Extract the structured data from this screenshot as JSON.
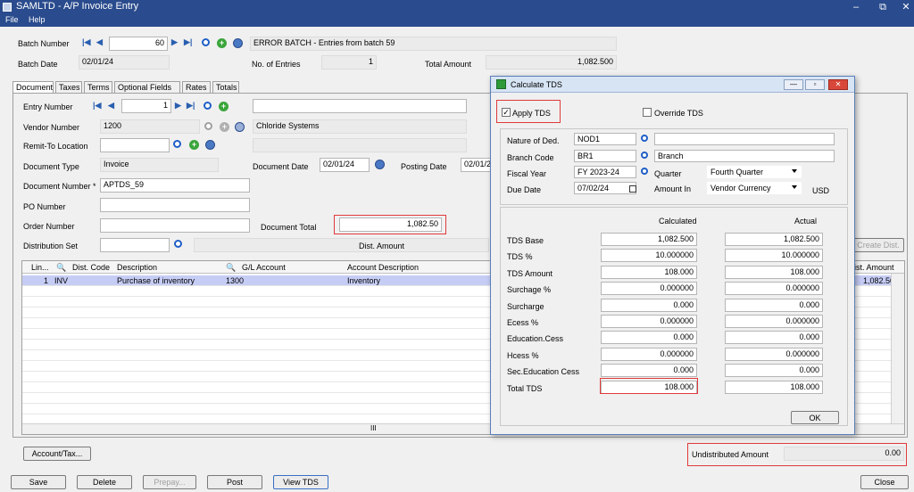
{
  "window": {
    "title": "SAMLTD - A/P Invoice Entry",
    "minimize": "–",
    "restore": "⧉",
    "close": "✕"
  },
  "menu": [
    "File",
    "Help"
  ],
  "header": {
    "batch_number_label": "Batch Number",
    "batch_number": "60",
    "batch_description": "ERROR BATCH - Entries from batch 59",
    "batch_date_label": "Batch Date",
    "batch_date": "02/01/24",
    "entries_label": "No. of Entries",
    "entries": "1",
    "total_amount_label": "Total Amount",
    "total_amount": "1,082.500"
  },
  "tabs": [
    "Document",
    "Taxes",
    "Terms",
    "Optional Fields",
    "Rates",
    "Totals"
  ],
  "document": {
    "entry_number_label": "Entry Number",
    "entry_number": "1",
    "vendor_number_label": "Vendor Number",
    "vendor_number": "1200",
    "vendor_name": "Chloride Systems",
    "remit_label": "Remit-To Location",
    "doc_type_label": "Document Type",
    "doc_type": "Invoice",
    "doc_date_label": "Document Date",
    "doc_date": "02/01/24",
    "posting_date_label": "Posting Date",
    "posting_date": "02/01/2",
    "doc_number_label": "Document Number *",
    "doc_number": "APTDS_59",
    "po_label": "PO Number",
    "order_label": "Order Number",
    "doc_total_label": "Document Total",
    "doc_total": "1,082.50",
    "dist_set_label": "Distribution Set",
    "dist_amount_label": "Dist. Amount",
    "create_dist": "Create Dist."
  },
  "grid": {
    "columns": [
      "Lin...",
      "Dist. Code",
      "Description",
      "G/L Account",
      "Account Description",
      "ist. Amount"
    ],
    "rows": [
      {
        "line": "1",
        "dist_code": "INV",
        "description": "Purchase of inventory",
        "gl_account": "1300",
        "account_description": "Inventory",
        "amount": "1,082.50"
      }
    ],
    "scroll_mark": "III"
  },
  "bottom": {
    "account_tax": "Account/Tax...",
    "undistributed_label": "Undistributed Amount",
    "undistributed": "0.00"
  },
  "buttons": {
    "save": "Save",
    "delete": "Delete",
    "prepay": "Prepay...",
    "post": "Post",
    "view_tds": "View TDS",
    "close": "Close"
  },
  "dialog": {
    "title": "Calculate TDS",
    "apply_tds": "Apply TDS",
    "apply_tds_checked": "✓",
    "override_tds": "Override TDS",
    "nature_label": "Nature of Ded.",
    "nature": "NOD1",
    "branch_label": "Branch Code",
    "branch": "BR1",
    "branch_desc": "Branch",
    "fiscal_label": "Fiscal Year",
    "fiscal": "FY 2023-24",
    "quarter_label": "Quarter",
    "quarter": "Fourth Quarter",
    "due_label": "Due Date",
    "due": "07/02/24",
    "amount_in_label": "Amount In",
    "amount_in": "Vendor Currency",
    "currency": "USD",
    "calc_header": "Calculated",
    "actual_header": "Actual",
    "rows": [
      {
        "label": "TDS Base",
        "calculated": "1,082.500",
        "actual": "1,082.500"
      },
      {
        "label": "TDS %",
        "calculated": "10.000000",
        "actual": "10.000000"
      },
      {
        "label": "TDS Amount",
        "calculated": "108.000",
        "actual": "108.000"
      },
      {
        "label": "Surchage %",
        "calculated": "0.000000",
        "actual": "0.000000"
      },
      {
        "label": "Surcharge",
        "calculated": "0.000",
        "actual": "0.000"
      },
      {
        "label": "Ecess %",
        "calculated": "0.000000",
        "actual": "0.000000"
      },
      {
        "label": "Education.Cess",
        "calculated": "0.000",
        "actual": "0.000"
      },
      {
        "label": "Hcess %",
        "calculated": "0.000000",
        "actual": "0.000000"
      },
      {
        "label": "Sec.Education Cess",
        "calculated": "0.000",
        "actual": "0.000"
      },
      {
        "label": "Total TDS",
        "calculated": "108.000",
        "actual": "108.000"
      }
    ],
    "ok": "OK"
  },
  "colors": {
    "title_bar": "#2a4b8d",
    "highlight": "#e03a3a",
    "selected_row": "#c6cdf5"
  }
}
